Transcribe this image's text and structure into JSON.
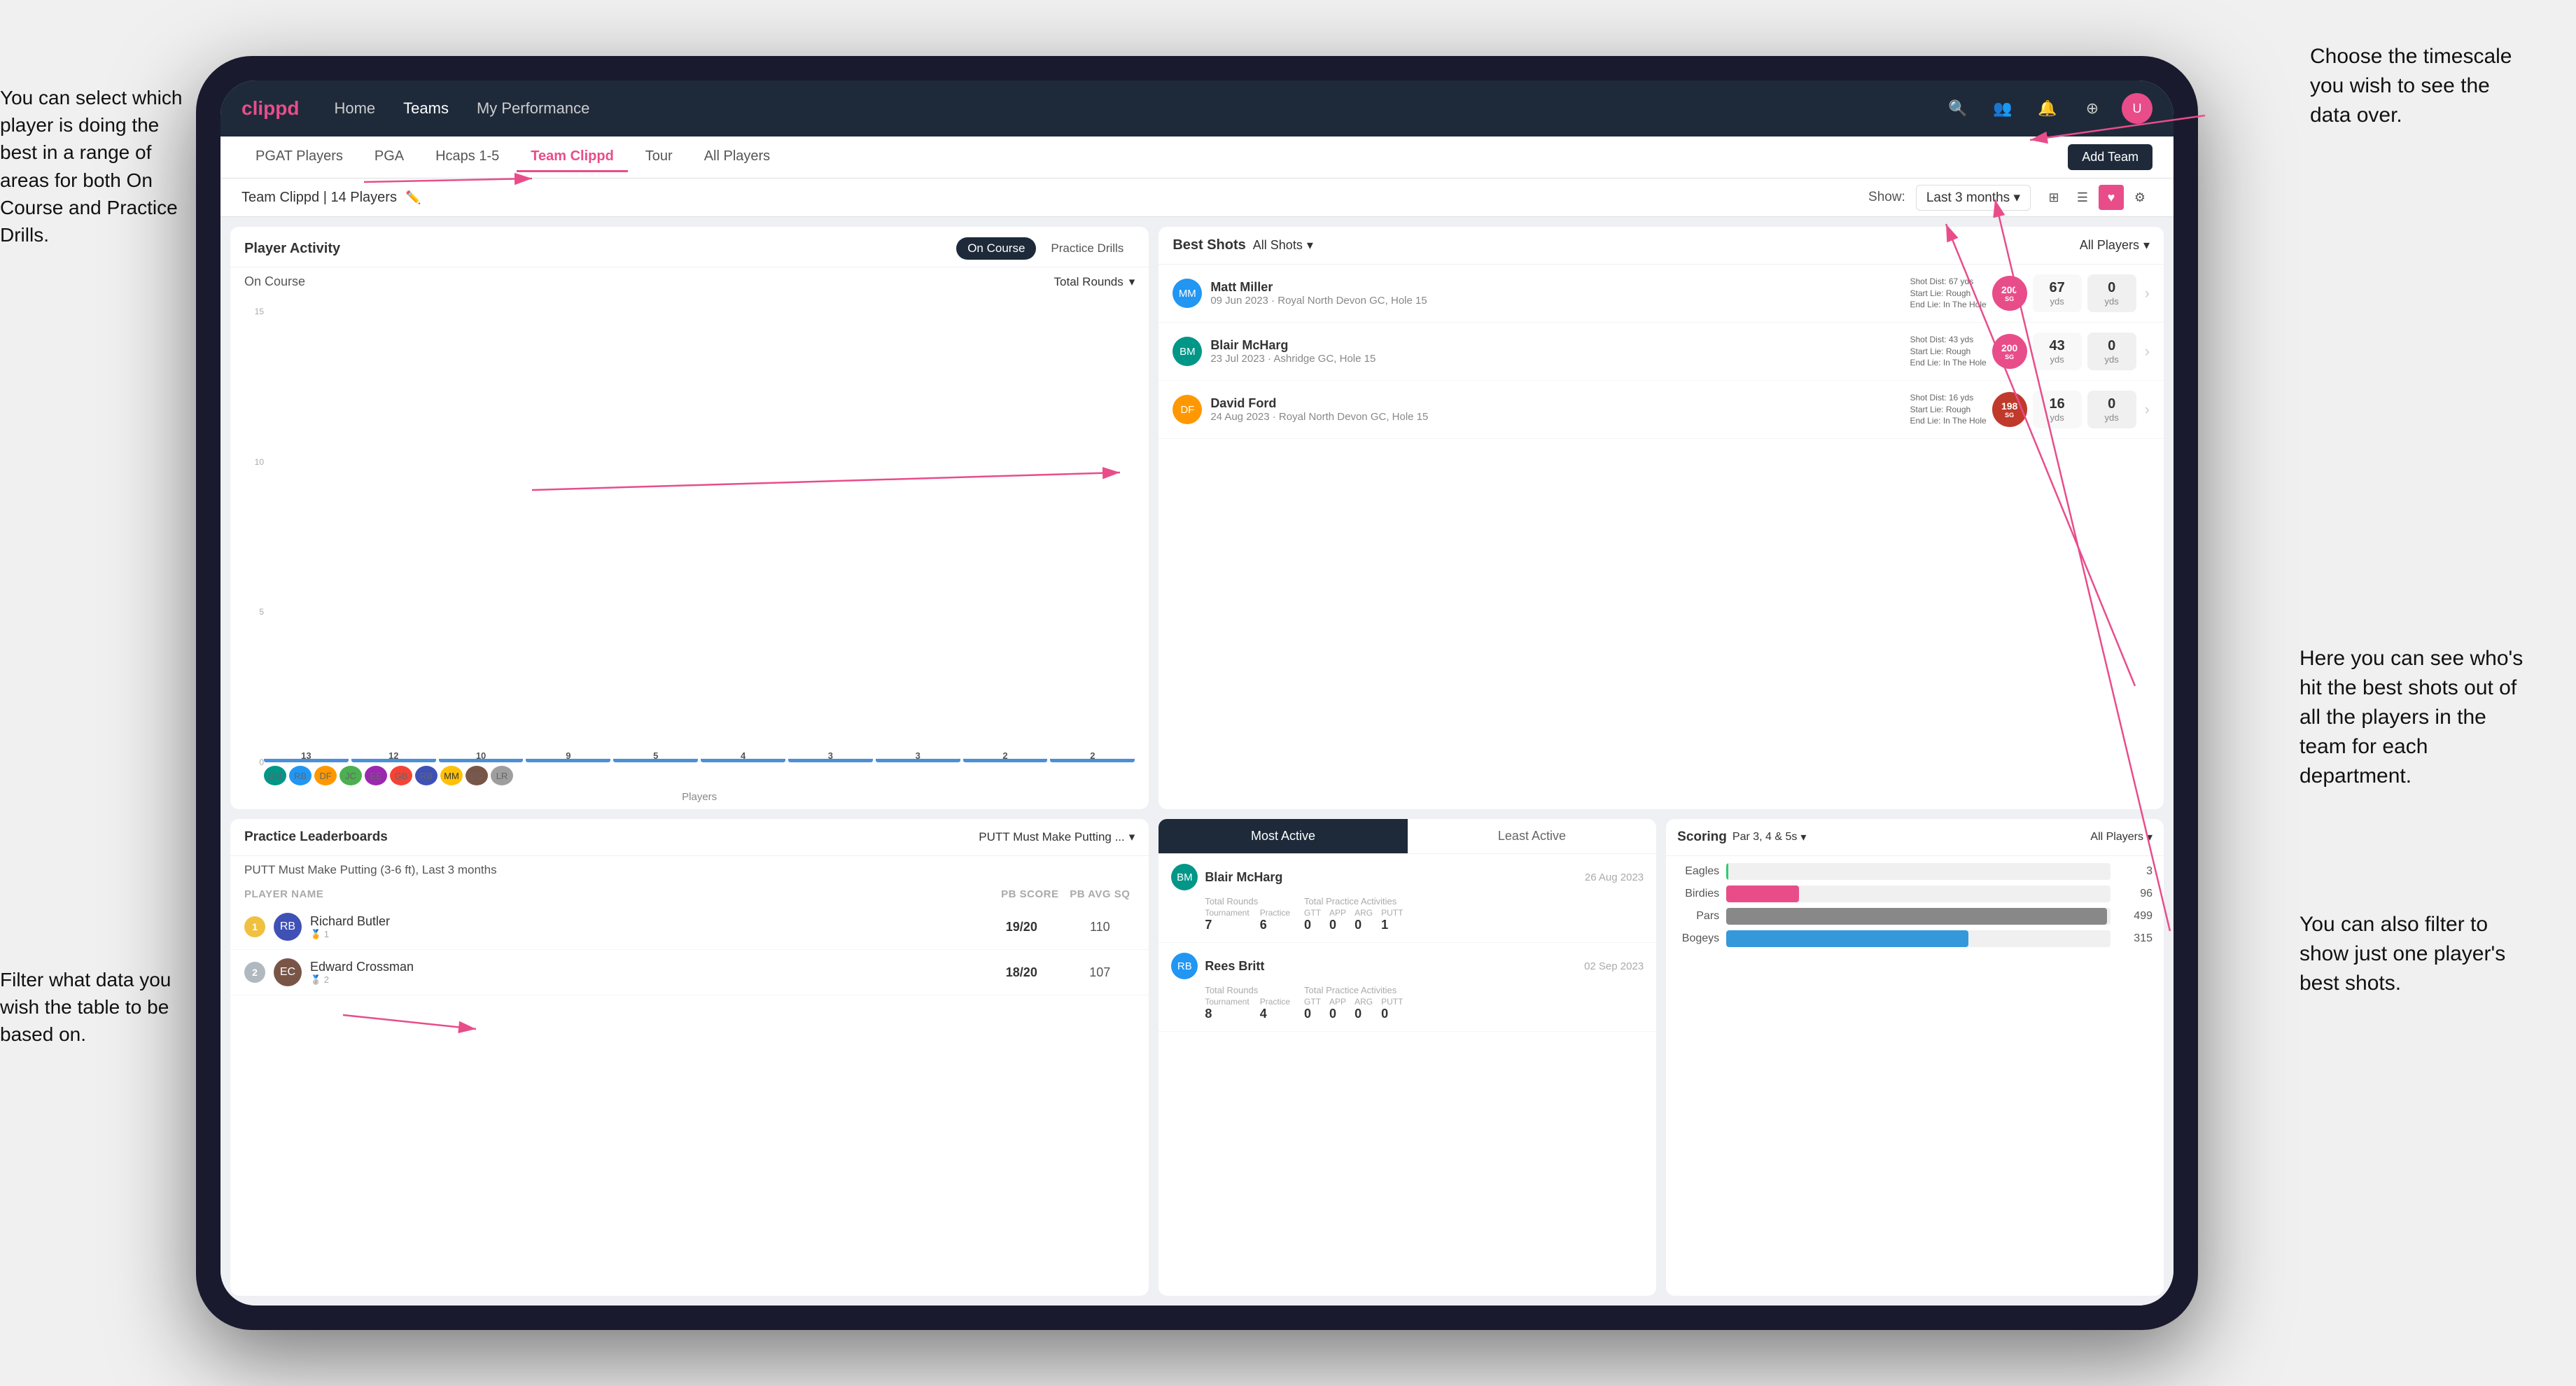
{
  "annotations": {
    "top_right": {
      "text": "Choose the timescale you wish to see the data over."
    },
    "left_top": {
      "text": "You can select which player is doing the best in a range of areas for both On Course and Practice Drills."
    },
    "left_bottom": {
      "text": "Filter what data you wish the table to be based on."
    },
    "right_bottom": {
      "text": "Here you can see who's hit the best shots out of all the players in the team for each department."
    },
    "right_bottom2": {
      "text": "You can also filter to show just one player's best shots."
    }
  },
  "navbar": {
    "logo": "clippd",
    "links": [
      "Home",
      "Teams",
      "My Performance"
    ],
    "active_link": "Teams"
  },
  "sub_tabs": {
    "tabs": [
      "PGAT Players",
      "PGA",
      "Hcaps 1-5",
      "Team Clippd",
      "Tour",
      "All Players"
    ],
    "active": "Team Clippd",
    "add_btn": "Add Team"
  },
  "team_header": {
    "name": "Team Clippd | 14 Players",
    "show_label": "Show:",
    "time_period": "Last 3 months",
    "time_period_full": "Last 3 months"
  },
  "player_activity": {
    "title": "Player Activity",
    "tabs": [
      "On Course",
      "Practice Drills"
    ],
    "active_tab": "On Course",
    "chart_section": "On Course",
    "chart_filter": "Total Rounds",
    "x_label": "Players",
    "y_labels": [
      "0",
      "5",
      "10",
      "15"
    ],
    "bars": [
      {
        "name": "B. McHarg",
        "value": 13,
        "height_pct": 87
      },
      {
        "name": "R. Britt",
        "value": 12,
        "height_pct": 80
      },
      {
        "name": "D. Ford",
        "value": 10,
        "height_pct": 67
      },
      {
        "name": "J. Coles",
        "value": 9,
        "height_pct": 60
      },
      {
        "name": "E. Ebert",
        "value": 5,
        "height_pct": 33
      },
      {
        "name": "G. Billingham",
        "value": 4,
        "height_pct": 27
      },
      {
        "name": "R. Butler",
        "value": 3,
        "height_pct": 20
      },
      {
        "name": "M. Miller",
        "value": 3,
        "height_pct": 20
      },
      {
        "name": "E. Crossman",
        "value": 2,
        "height_pct": 13
      },
      {
        "name": "L. Robertson",
        "value": 2,
        "height_pct": 13
      }
    ]
  },
  "best_shots": {
    "title": "Best Shots",
    "filter1": "All Shots",
    "filter2": "All Players",
    "players": [
      {
        "name": "Matt Miller",
        "date": "09 Jun 2023",
        "course": "Royal North Devon GC",
        "hole": "Hole 15",
        "badge": "200",
        "badge_sub": "SG",
        "shot_dist": "Shot Dist: 67 yds",
        "start_lie": "Start Lie: Rough",
        "end_lie": "End Lie: In The Hole",
        "stat1_val": "67",
        "stat1_unit": "yds",
        "stat2_val": "0",
        "stat2_unit": "yds"
      },
      {
        "name": "Blair McHarg",
        "date": "23 Jul 2023",
        "course": "Ashridge GC",
        "hole": "Hole 15",
        "badge": "200",
        "badge_sub": "SG",
        "shot_dist": "Shot Dist: 43 yds",
        "start_lie": "Start Lie: Rough",
        "end_lie": "End Lie: In The Hole",
        "stat1_val": "43",
        "stat1_unit": "yds",
        "stat2_val": "0",
        "stat2_unit": "yds"
      },
      {
        "name": "David Ford",
        "date": "24 Aug 2023",
        "course": "Royal North Devon GC",
        "hole": "Hole 15",
        "badge": "198",
        "badge_sub": "SG",
        "shot_dist": "Shot Dist: 16 yds",
        "start_lie": "Start Lie: Rough",
        "end_lie": "End Lie: In The Hole",
        "stat1_val": "16",
        "stat1_unit": "yds",
        "stat2_val": "0",
        "stat2_unit": "yds"
      }
    ]
  },
  "practice_lb": {
    "title": "Practice Leaderboards",
    "filter": "PUTT Must Make Putting ...",
    "subtitle": "PUTT Must Make Putting (3-6 ft), Last 3 months",
    "headers": {
      "player": "PLAYER NAME",
      "pb": "PB SCORE",
      "avg": "PB AVG SQ"
    },
    "rows": [
      {
        "rank": 1,
        "name": "Richard Butler",
        "pb": "19/20",
        "avg": "110"
      },
      {
        "rank": 2,
        "name": "Edward Crossman",
        "pb": "18/20",
        "avg": "107"
      }
    ]
  },
  "most_active": {
    "tabs": [
      "Most Active",
      "Least Active"
    ],
    "active_tab": "Most Active",
    "players": [
      {
        "name": "Blair McHarg",
        "date": "26 Aug 2023",
        "total_rounds_label": "Total Rounds",
        "tournament": 7,
        "practice_rounds": 6,
        "total_practice_label": "Total Practice Activities",
        "gtt": 0,
        "app": 0,
        "arg": 0,
        "putt": 1
      },
      {
        "name": "Rees Britt",
        "date": "02 Sep 2023",
        "total_rounds_label": "Total Rounds",
        "tournament": 8,
        "practice_rounds": 4,
        "total_practice_label": "Total Practice Activities",
        "gtt": 0,
        "app": 0,
        "arg": 0,
        "putt": 0
      }
    ]
  },
  "scoring": {
    "title": "Scoring",
    "filter": "Par 3, 4 & 5s",
    "players_filter": "All Players",
    "rows": [
      {
        "label": "Eagles",
        "value": 3,
        "max": 500,
        "color": "#2ecc71"
      },
      {
        "label": "Birdies",
        "value": 96,
        "max": 500,
        "color": "#e84d8a"
      },
      {
        "label": "Pars",
        "value": 499,
        "max": 500,
        "color": "#888"
      },
      {
        "label": "Bogeys",
        "value": 315,
        "max": 500,
        "color": "#3498db"
      }
    ]
  }
}
